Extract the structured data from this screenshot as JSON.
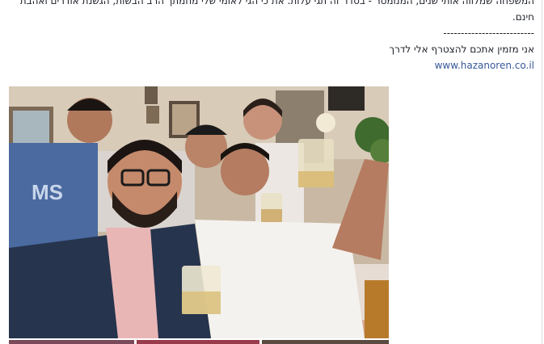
{
  "post": {
    "lines": [
      "המשפחה שמלווה אותי שנים, המנומטר - בסדר זה תגי עלות. את כי הגי לאומי שלי מחמתך הרב הבשות, הגשנת אודרים ואהבת",
      "חינם.",
      "--------------------------",
      "אני מזמין אתכם להצטרף אלי לדרך",
      "www.hazanoren.co.il"
    ]
  },
  "photo": {
    "alt": "selfie-with-glasses-raised"
  },
  "colors": {
    "link": "#365899",
    "text": "#1d2129"
  }
}
